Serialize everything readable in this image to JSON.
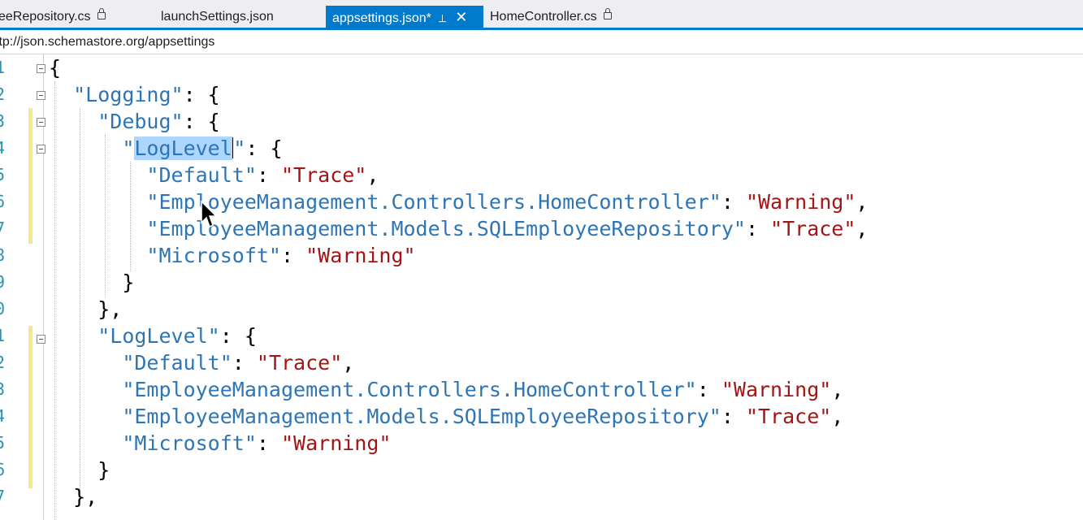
{
  "tabs": [
    {
      "label": "eeRepository.cs",
      "locked": true,
      "active": false
    },
    {
      "label": "launchSettings.json",
      "locked": false,
      "active": false
    },
    {
      "label": "appsettings.json*",
      "locked": false,
      "active": true
    },
    {
      "label": "HomeController.cs",
      "locked": true,
      "active": false
    }
  ],
  "schema_url": "ttp://json.schemastore.org/appsettings",
  "line_numbers": [
    "1",
    "2",
    "3",
    "4",
    "5",
    "6",
    "7",
    "8",
    "9",
    "0",
    "1",
    "2",
    "3",
    "4",
    "5",
    "6",
    "7"
  ],
  "code": {
    "t_logging": "\"Logging\"",
    "t_debug": "\"Debug\"",
    "t_loglevel": "\"LogLevel\"",
    "t_default": "\"Default\"",
    "t_trace": "\"Trace\"",
    "t_home_controller": "\"EmployeeManagement.Controllers.HomeController\"",
    "t_warning": "\"Warning\"",
    "t_sql_repo": "\"EmployeeManagement.Models.SQLEmployeeRepository\"",
    "t_microsoft": "\"Microsoft\"",
    "selected_word": "LogLevel"
  },
  "colors": {
    "accent": "#007acc",
    "key": "#2e75b6",
    "string": "#a31515",
    "line_number": "#2b91af",
    "selection": "#add6ff",
    "changed_margin": "#f4e98a"
  }
}
